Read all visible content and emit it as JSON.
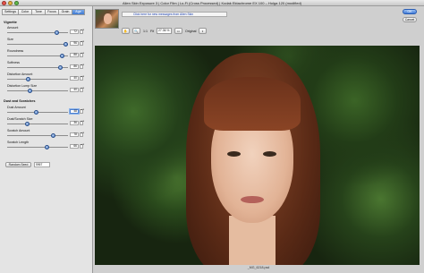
{
  "window": {
    "title": "Alien Skin Exposure 3 | Color Film | Lo-Fi (Cross Processed) | Kodak Ektachrome EX 100 – Holga 120 (modified)"
  },
  "tabs": [
    {
      "label": "Settings",
      "active": false
    },
    {
      "label": "Color",
      "active": false
    },
    {
      "label": "Tone",
      "active": false
    },
    {
      "label": "Focus",
      "active": false
    },
    {
      "label": "Grain",
      "active": false
    },
    {
      "label": "Age",
      "active": true
    }
  ],
  "vignette": {
    "heading": "Vignette",
    "sliders": [
      {
        "label": "Amount",
        "value": "72"
      },
      {
        "label": "Size",
        "value": "96"
      },
      {
        "label": "Roundness",
        "value": "88"
      },
      {
        "label": "Softness",
        "value": "86"
      },
      {
        "label": "Distortion Amount",
        "value": "40"
      },
      {
        "label": "Distortion Lump Size",
        "value": "40"
      }
    ]
  },
  "dust": {
    "heading": "Dust and Scratches",
    "sliders": [
      {
        "label": "Dust Amount",
        "value": "48"
      },
      {
        "label": "Dust/Scratch Size",
        "value": "36"
      },
      {
        "label": "Scratch Amount",
        "value": "78"
      },
      {
        "label": "Scratch Length",
        "value": "66"
      }
    ]
  },
  "random_seed": {
    "button_label": "Random Seed",
    "value": "5967"
  },
  "messages": {
    "text": "Click here for new messages from Alien Skin"
  },
  "toolbar": {
    "ratio_label": "1:1",
    "fit_label": "Fit",
    "zoom_value": "27.36 %",
    "original_label": "Original"
  },
  "dialog": {
    "ok_label": "OK",
    "cancel_label": "Cancel"
  },
  "footer": {
    "filename": "_MG_6218.psd"
  },
  "colors": {
    "accent": "#3f7ad6",
    "active_tab": "#3d79d2"
  }
}
